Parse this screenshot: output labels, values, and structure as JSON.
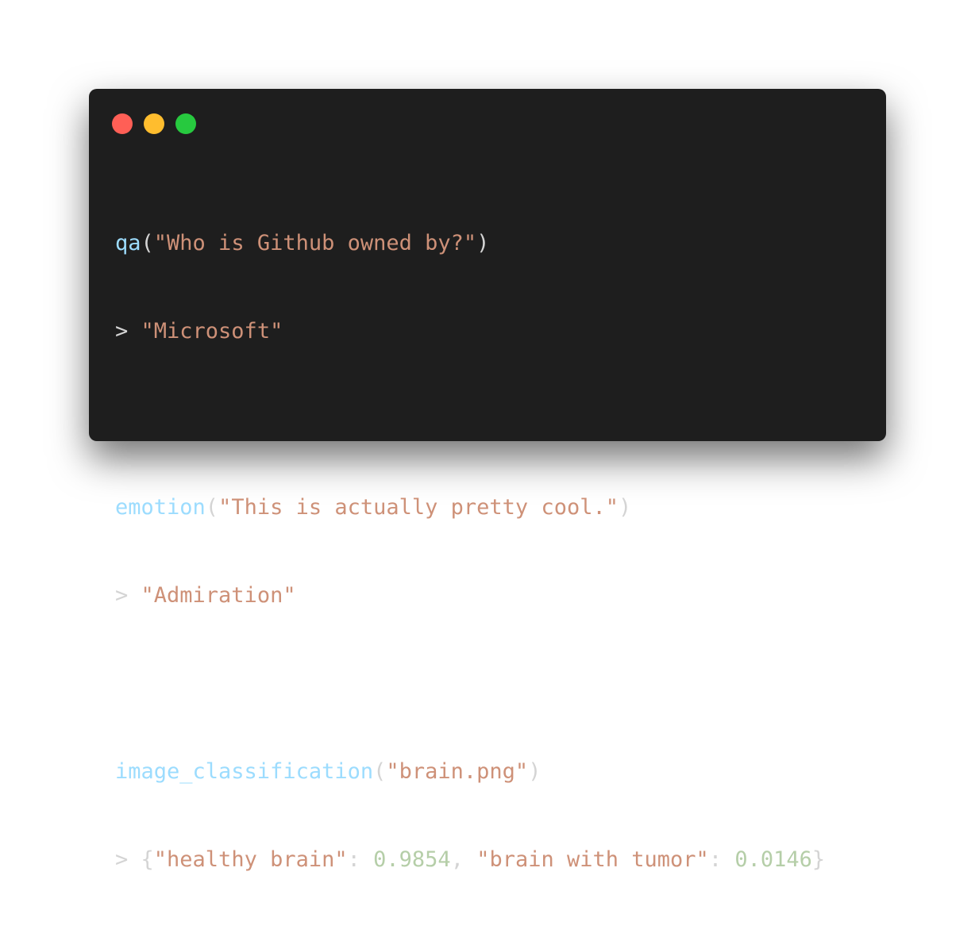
{
  "window": {
    "background": "#1e1e1e",
    "controls": [
      {
        "name": "close",
        "color": "#ff5f56"
      },
      {
        "name": "minimize",
        "color": "#ffbd2e"
      },
      {
        "name": "maximize",
        "color": "#27c93f"
      }
    ]
  },
  "colors": {
    "function": "#9cdcfe",
    "string": "#ce9178",
    "number": "#b5cea8",
    "punctuation": "#d4d4d4"
  },
  "code": {
    "qa": {
      "fn": "qa",
      "open": "(",
      "arg": "\"Who is Github owned by?\"",
      "close": ")",
      "prompt": "> ",
      "result": "\"Microsoft\""
    },
    "emotion": {
      "fn": "emotion",
      "open": "(",
      "arg": "\"This is actually pretty cool.\"",
      "close": ")",
      "prompt": "> ",
      "result": "\"Admiration\""
    },
    "image_classification": {
      "fn": "image_classification",
      "open": "(",
      "arg": "\"brain.png\"",
      "close": ")",
      "prompt": "> ",
      "brace_open": "{",
      "key1": "\"healthy brain\"",
      "colon1": ": ",
      "val1": "0.9854",
      "comma": ", ",
      "key2": "\"brain with tumor\"",
      "colon2": ": ",
      "val2": "0.0146",
      "brace_close": "}"
    }
  }
}
